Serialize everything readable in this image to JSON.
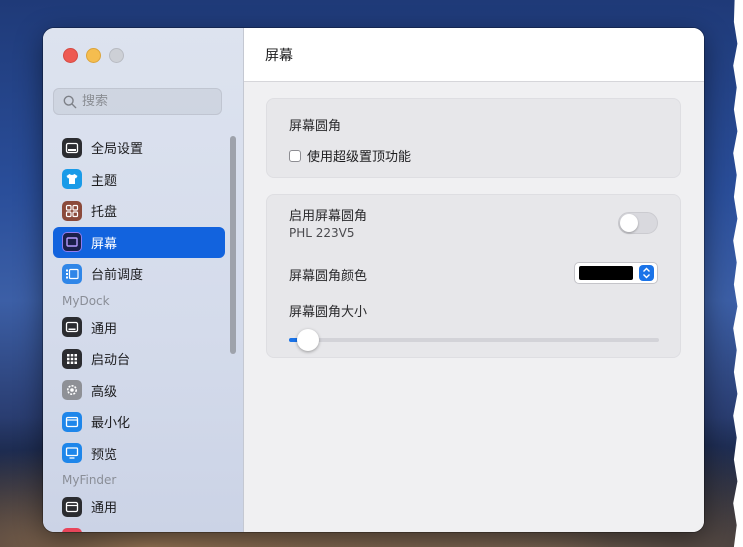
{
  "search": {
    "placeholder": "搜索"
  },
  "sidebar": {
    "items": [
      {
        "label": "全局设置",
        "icon": "settings-panel-icon",
        "active": false
      },
      {
        "label": "主题",
        "icon": "tshirt-icon",
        "active": false
      },
      {
        "label": "托盘",
        "icon": "grid-icon",
        "active": false
      },
      {
        "label": "屏幕",
        "icon": "display-icon",
        "active": true
      },
      {
        "label": "台前调度",
        "icon": "stage-manager-icon",
        "active": false
      }
    ],
    "sections": [
      {
        "title": "MyDock",
        "items": [
          {
            "label": "通用",
            "icon": "dock-general-icon"
          },
          {
            "label": "启动台",
            "icon": "launchpad-icon"
          },
          {
            "label": "高级",
            "icon": "gear-icon"
          },
          {
            "label": "最小化",
            "icon": "minimize-window-icon"
          },
          {
            "label": "预览",
            "icon": "preview-monitor-icon"
          }
        ]
      },
      {
        "title": "MyFinder",
        "items": [
          {
            "label": "通用",
            "icon": "finder-general-icon"
          }
        ]
      }
    ]
  },
  "main": {
    "title": "屏幕",
    "card1": {
      "title": "屏幕圆角",
      "checkbox_label": "使用超级置顶功能",
      "checked": false
    },
    "card2": {
      "toggle_label": "启用屏幕圆角",
      "display_name": "PHL 223V5",
      "toggle_on": false,
      "color_label": "屏幕圆角颜色",
      "color_value": "#000000",
      "size_label": "屏幕圆角大小",
      "size_value_fraction": 0.05
    }
  },
  "colors": {
    "accent": "#1263de",
    "close": "#ee5a52",
    "minimize": "#f5bd4f",
    "zoom_inactive": "#cdd0d6"
  }
}
